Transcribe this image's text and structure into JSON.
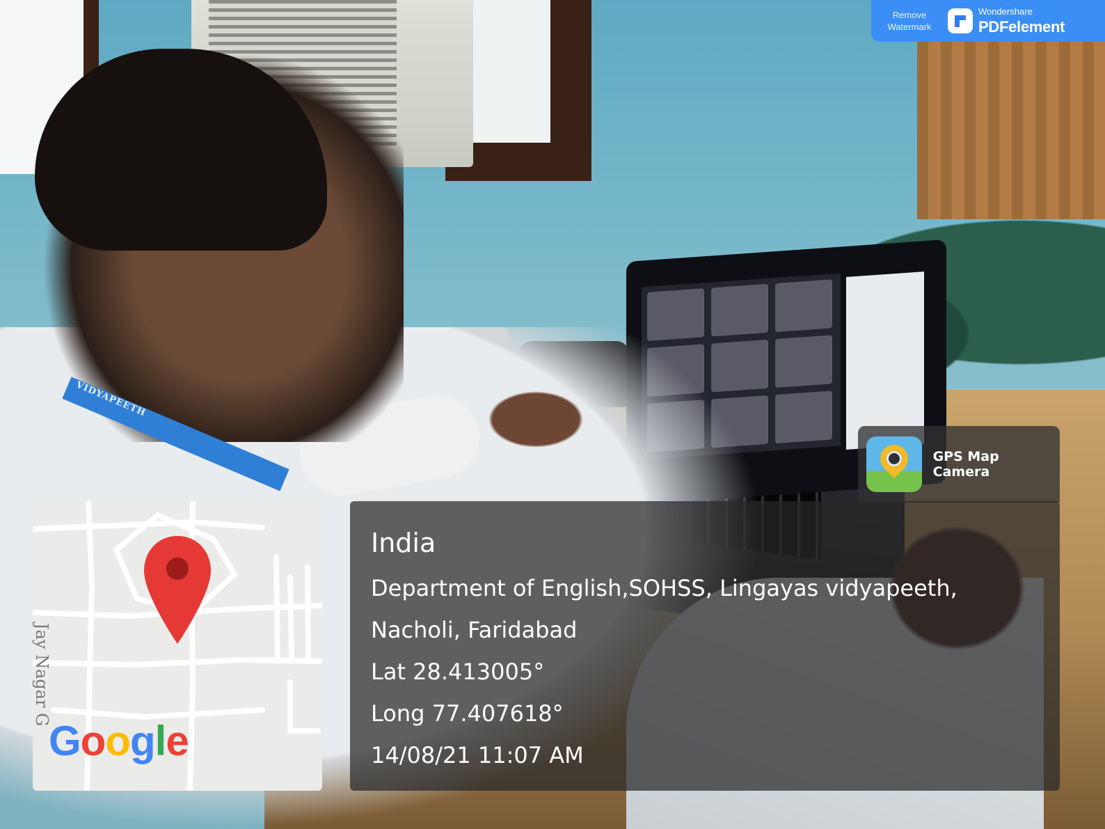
{
  "watermark": {
    "remove_label": "Remove Watermark",
    "brand_small": "Wondershare",
    "brand_big": "PDFelement",
    "accent": "#3b8ef5"
  },
  "gps_badge": {
    "label": "GPS Map Camera",
    "icon": "map-pin-camera-icon"
  },
  "map": {
    "road_label": "Jay Nagar G",
    "logo_text": [
      "G",
      "o",
      "o",
      "g",
      "l",
      "e"
    ],
    "pin_icon": "location-pin-icon",
    "pin_color": "#e53935"
  },
  "location": {
    "country": "India",
    "address_line1": "Department of English,SOHSS, Lingayas vidyapeeth,",
    "address_line2": "Nacholi, Faridabad",
    "latitude": "Lat 28.413005°",
    "longitude": "Long 77.407618°",
    "datetime": "14/08/21 11:07 AM"
  },
  "lanyard": {
    "text": "VIDYAPEETH"
  }
}
